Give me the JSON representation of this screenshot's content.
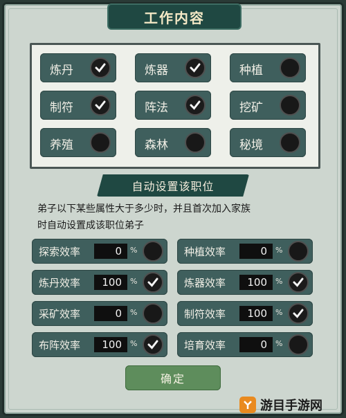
{
  "header": {
    "title": "工作内容"
  },
  "jobs": [
    {
      "label": "炼丹",
      "checked": true
    },
    {
      "label": "炼器",
      "checked": true
    },
    {
      "label": "种植",
      "checked": false
    },
    {
      "label": "制符",
      "checked": true
    },
    {
      "label": "阵法",
      "checked": true
    },
    {
      "label": "挖矿",
      "checked": false
    },
    {
      "label": "养殖",
      "checked": false
    },
    {
      "label": "森林",
      "checked": false
    },
    {
      "label": "秘境",
      "checked": false
    }
  ],
  "auto_section": {
    "title": "自动设置该职位",
    "description_line1": "弟子以下某些属性大于多少时，并且首次加入家族",
    "description_line2": "时自动设置成该职位弟子"
  },
  "stats": [
    {
      "label": "探索效率",
      "value": "0",
      "unit": "%",
      "checked": false
    },
    {
      "label": "种植效率",
      "value": "0",
      "unit": "%",
      "checked": false
    },
    {
      "label": "炼丹效率",
      "value": "100",
      "unit": "%",
      "checked": true
    },
    {
      "label": "炼器效率",
      "value": "100",
      "unit": "%",
      "checked": true
    },
    {
      "label": "采矿效率",
      "value": "0",
      "unit": "%",
      "checked": false
    },
    {
      "label": "制符效率",
      "value": "100",
      "unit": "%",
      "checked": true
    },
    {
      "label": "布阵效率",
      "value": "100",
      "unit": "%",
      "checked": true
    },
    {
      "label": "培育效率",
      "value": "0",
      "unit": "%",
      "checked": false
    }
  ],
  "footer": {
    "confirm_label": "确定"
  },
  "watermark": {
    "text": "游目手游网"
  },
  "colors": {
    "panel_teal": "#3f5f5d",
    "banner": "#1f4842",
    "confirm_green": "#5e8d5c",
    "title_text": "#f5e9c6"
  }
}
